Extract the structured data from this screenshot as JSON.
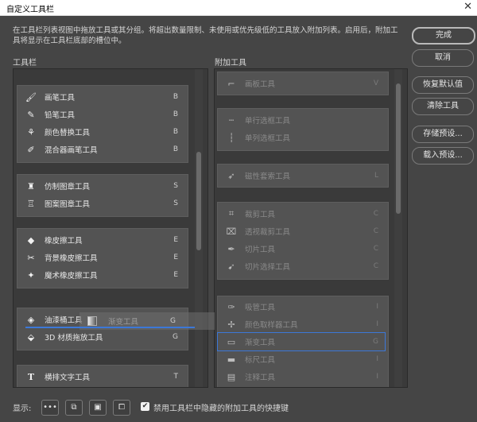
{
  "window": {
    "title": "自定义工具栏",
    "close": "✕"
  },
  "description": "在工具栏列表视图中拖放工具或其分组。将超出数量限制、未使用或优先级低的工具放入附加列表。启用后，附加工具将显示在工具栏底部的槽位中。",
  "left_panel": {
    "label": "工具栏",
    "groups": [
      {
        "tools": [
          {
            "name": "画笔工具",
            "key": "B",
            "icon": "brush-icon",
            "glyph": "🖌"
          },
          {
            "name": "铅笔工具",
            "key": "B",
            "icon": "pencil-icon",
            "glyph": "✎"
          },
          {
            "name": "颜色替换工具",
            "key": "B",
            "icon": "color-replace-icon",
            "glyph": "⚘"
          },
          {
            "name": "混合器画笔工具",
            "key": "B",
            "icon": "mixer-brush-icon",
            "glyph": "✐"
          }
        ]
      },
      {
        "tools": [
          {
            "name": "仿制图章工具",
            "key": "S",
            "icon": "clone-stamp-icon",
            "glyph": "♜"
          },
          {
            "name": "图案图章工具",
            "key": "S",
            "icon": "pattern-stamp-icon",
            "glyph": "♖"
          }
        ]
      },
      {
        "tools": [
          {
            "name": "橡皮擦工具",
            "key": "E",
            "icon": "eraser-icon",
            "glyph": "◆"
          },
          {
            "name": "背景橡皮擦工具",
            "key": "E",
            "icon": "background-eraser-icon",
            "glyph": "✂"
          },
          {
            "name": "魔术橡皮擦工具",
            "key": "E",
            "icon": "magic-eraser-icon",
            "glyph": "✦"
          }
        ]
      },
      {
        "tools": [
          {
            "name": "油漆桶工具",
            "key": "",
            "icon": "paint-bucket-icon",
            "glyph": "◈"
          },
          {
            "name": "3D 材质拖放工具",
            "key": "G",
            "icon": "3d-material-drop-icon",
            "glyph": "⬙"
          }
        ]
      },
      {
        "tools": [
          {
            "name": "横排文字工具",
            "key": "T",
            "icon": "type-icon",
            "glyph": "T"
          }
        ]
      }
    ]
  },
  "drag_ghost": {
    "name": "渐变工具",
    "key": "G"
  },
  "right_panel": {
    "label": "附加工具",
    "groups": [
      {
        "tools": [
          {
            "name": "画板工具",
            "key": "V",
            "icon": "artboard-icon",
            "glyph": "⌐"
          }
        ]
      },
      {
        "tools": [
          {
            "name": "单行选框工具",
            "key": "",
            "icon": "single-row-marquee-icon",
            "glyph": "┄"
          },
          {
            "name": "单列选框工具",
            "key": "",
            "icon": "single-column-marquee-icon",
            "glyph": "┆"
          }
        ]
      },
      {
        "tools": [
          {
            "name": "磁性套索工具",
            "key": "L",
            "icon": "magnetic-lasso-icon",
            "glyph": "➶"
          }
        ]
      },
      {
        "tools": [
          {
            "name": "裁剪工具",
            "key": "C",
            "icon": "crop-icon",
            "glyph": "⌗"
          },
          {
            "name": "透视裁剪工具",
            "key": "C",
            "icon": "perspective-crop-icon",
            "glyph": "⌧"
          },
          {
            "name": "切片工具",
            "key": "C",
            "icon": "slice-icon",
            "glyph": "✒"
          },
          {
            "name": "切片选择工具",
            "key": "C",
            "icon": "slice-select-icon",
            "glyph": "➹"
          }
        ]
      },
      {
        "tools": [
          {
            "name": "吸管工具",
            "key": "I",
            "icon": "eyedropper-icon",
            "glyph": "✑"
          },
          {
            "name": "颜色取样器工具",
            "key": "I",
            "icon": "color-sampler-icon",
            "glyph": "✢"
          },
          {
            "name": "渐变工具",
            "key": "G",
            "icon": "gradient-icon",
            "glyph": "▭"
          },
          {
            "name": "标尺工具",
            "key": "I",
            "icon": "ruler-icon",
            "glyph": "▬"
          },
          {
            "name": "注释工具",
            "key": "I",
            "icon": "note-icon",
            "glyph": "▤"
          }
        ]
      }
    ]
  },
  "buttons": {
    "done": "完成",
    "cancel": "取消",
    "restore_defaults": "恢复默认值",
    "clear_tools": "清除工具",
    "save_preset": "存储预设...",
    "load_preset": "载入预设..."
  },
  "bottom": {
    "show_label": "显示:",
    "show_buttons": [
      "•••",
      "⧉",
      "▣",
      "⧠"
    ],
    "checkbox_checked": true,
    "checkbox_label": "禁用工具栏中隐藏的附加工具的快捷键"
  },
  "colors": {
    "bg": "#454545",
    "panel": "#3a3a3a",
    "group": "#535353",
    "accent": "#3c78d8"
  }
}
